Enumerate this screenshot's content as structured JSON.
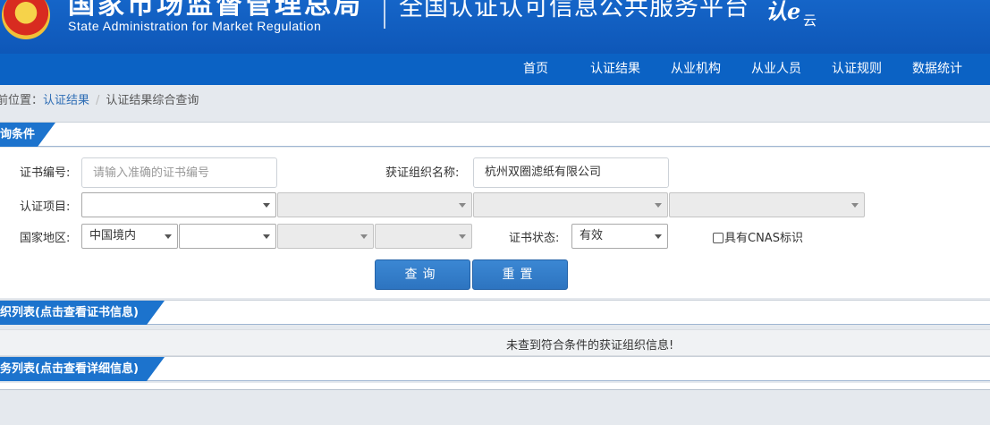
{
  "header": {
    "title_cn": "国家市场监督管理总局",
    "title_en": "State Administration  for  Market Regulation",
    "platform": "全国认证认可信息公共服务平台",
    "logo_text": "认e",
    "logo_small": "云"
  },
  "nav": {
    "items": [
      {
        "label": "首页"
      },
      {
        "label": "认证结果"
      },
      {
        "label": "从业机构"
      },
      {
        "label": "从业人员"
      },
      {
        "label": "认证规则"
      },
      {
        "label": "数据统计"
      }
    ]
  },
  "breadcrumb": {
    "prefix": "前位置：",
    "link": "认证结果",
    "separator": "/",
    "current": "认证结果综合查询"
  },
  "query_panel": {
    "tab": "询条件",
    "cert_no_label": "证书编号:",
    "cert_no_placeholder": "请输入准确的证书编号",
    "cert_no_value": "",
    "org_label": "获证组织名称:",
    "org_value": "杭州双圈滤纸有限公司",
    "project_label": "认证项目:",
    "project_selects": [
      "",
      "",
      "",
      ""
    ],
    "region_label": "国家地区:",
    "region_selects": [
      "中国境内",
      "",
      "",
      ""
    ],
    "status_label": "证书状态:",
    "status_value": "有效",
    "cnas_label": "具有CNAS标识",
    "search_button": "查询",
    "reset_button": "重置"
  },
  "cert_list": {
    "tab": "织列表(点击查看证书信息)",
    "empty_message": "未查到符合条件的获证组织信息!"
  },
  "detail_list": {
    "tab": "务列表(点击查看详细信息)"
  },
  "colors": {
    "header_blue": "#1565c8",
    "nav_blue": "#0b62c4",
    "tab_blue": "#1c73cd",
    "button_blue": "#2d74c0",
    "link_blue": "#2f6eb5"
  }
}
